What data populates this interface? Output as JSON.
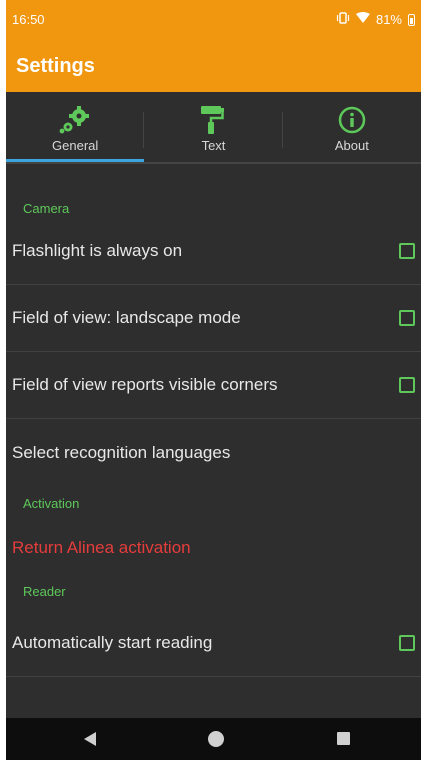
{
  "status": {
    "time": "16:50",
    "battery": "81%",
    "vibrate_icon": "vibrate-icon",
    "wifi_icon": "wifi-icon",
    "battery_icon": "battery-icon"
  },
  "appbar": {
    "title": "Settings"
  },
  "tabs": [
    {
      "label": "General",
      "icon": "gears-icon",
      "active": true
    },
    {
      "label": "Text",
      "icon": "paint-roller-icon",
      "active": false
    },
    {
      "label": "About",
      "icon": "info-icon",
      "active": false
    }
  ],
  "sections": {
    "camera": {
      "header": "Camera",
      "items": [
        {
          "label": "Flashlight is always on",
          "checked": false
        },
        {
          "label": "Field of view: landscape mode",
          "checked": false
        },
        {
          "label": "Field of view reports visible corners",
          "checked": false
        },
        {
          "label": "Select recognition languages"
        }
      ]
    },
    "activation": {
      "header": "Activation",
      "items": [
        {
          "label": "Return Alinea activation"
        }
      ]
    },
    "reader": {
      "header": "Reader",
      "items": [
        {
          "label": "Automatically start reading",
          "checked": false
        }
      ]
    }
  },
  "colors": {
    "accent": "#f0960f",
    "background": "#2e2e2e",
    "section_header": "#5ec85a",
    "tab_indicator": "#3aa6dd",
    "danger": "#e53c3c"
  },
  "navbar": {
    "back_icon": "back-icon",
    "home_icon": "home-icon",
    "recents_icon": "recents-icon"
  }
}
